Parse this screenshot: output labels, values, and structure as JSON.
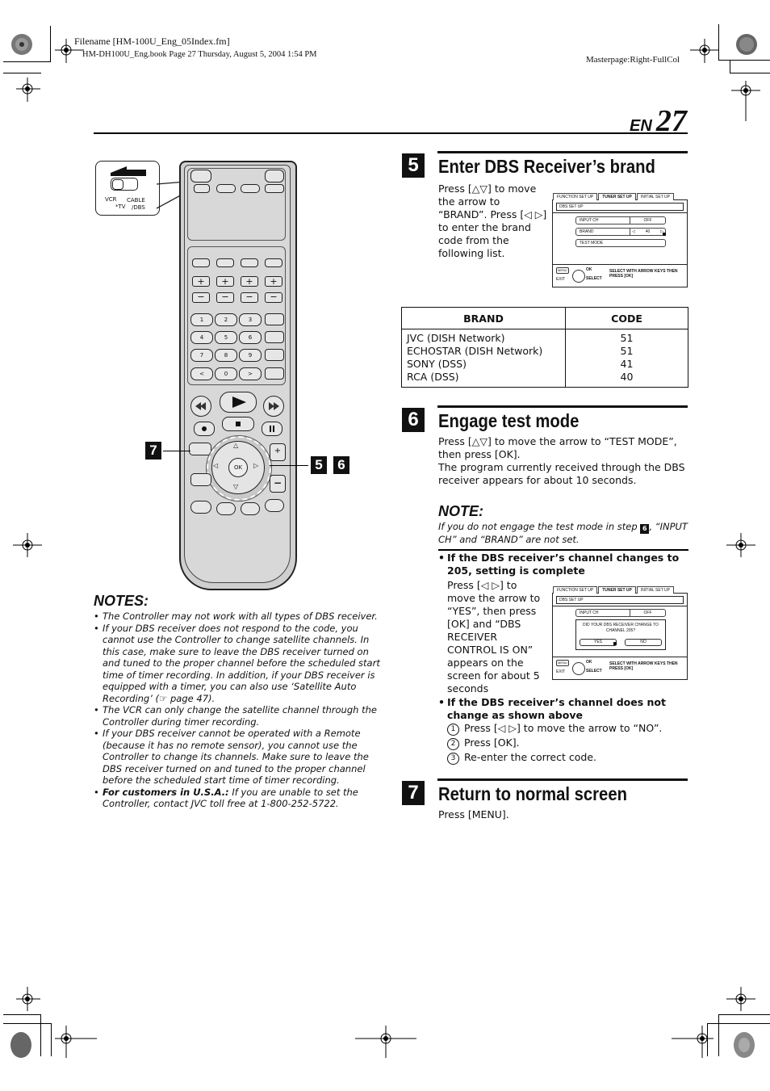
{
  "header": {
    "filename": "Filename [HM-100U_Eng_05Index.fm]",
    "book_info": "HM-DH100U_Eng.book  Page 27  Thursday, August 5, 2004  1:54 PM",
    "masterpage": "Masterpage:Right-FullCol",
    "page_lang": "EN",
    "page_number": "27"
  },
  "remote": {
    "switch_labels": {
      "vcr": "VCR",
      "tv": "*TV",
      "cable": "CABLE",
      "dbs": "/DBS"
    },
    "number_keys": [
      "1",
      "2",
      "3",
      "4",
      "5",
      "6",
      "7",
      "8",
      "9",
      "<",
      "0",
      ">"
    ],
    "ok_label": "OK",
    "callouts": {
      "menu": "7",
      "arrows_a": "5",
      "arrows_b": "6"
    },
    "icons": [
      "play-icon",
      "rewind-icon",
      "fast-forward-icon",
      "record-icon",
      "stop-icon",
      "pause-icon",
      "up-arrow-icon",
      "down-arrow-icon",
      "left-arrow-icon",
      "right-arrow-icon"
    ]
  },
  "notes": {
    "title": "NOTES:",
    "items": [
      {
        "bold": "",
        "text": "The Controller may not work with all types of DBS receiver."
      },
      {
        "bold": "",
        "text": "If your DBS receiver does not respond to the code, you cannot use the Controller to change satellite channels. In this case, make sure to leave the DBS receiver turned on and tuned to the proper channel before the scheduled start time of timer recording. In addition, if your DBS receiver is equipped with a timer, you can also use ‘Satellite Auto Recording’ (☞ page 47)."
      },
      {
        "bold": "",
        "text": "The VCR can only change the satellite channel through the Controller during timer recording."
      },
      {
        "bold": "",
        "text": "If your DBS receiver cannot be operated with a Remote (because it has no remote sensor), you cannot use the Controller to change its channels. Make sure to leave the DBS receiver turned on and tuned to the proper channel before the scheduled start time of timer recording."
      },
      {
        "bold": "For customers in U.S.A.:",
        "text": " If you are unable to set the Controller, contact JVC toll free at 1-800-252-5722."
      }
    ]
  },
  "step5": {
    "number": "5",
    "title": "Enter DBS Receiver’s brand",
    "text": "Press [△▽] to move the arrow to “BRAND”. Press [◁ ▷] to enter the brand code from the following list.",
    "screen": {
      "tabs": [
        "FUNCTION SET UP",
        "TUNER SET UP",
        "INITIAL SET UP"
      ],
      "active_tab": "TUNER SET UP",
      "title": "DBS SET UP",
      "rows": [
        {
          "label": "INPUT CH",
          "value": "OFF"
        },
        {
          "label": "BRAND",
          "value": "40"
        },
        {
          "label": "TEST MODE",
          "value": ""
        }
      ],
      "footer_menu": "MENU",
      "footer_exit": "EXIT",
      "footer_ok": "OK",
      "footer_select": "SELECT",
      "footer_hint": "SELECT WITH ARROW KEYS THEN PRESS [OK]"
    }
  },
  "brand_table": {
    "headers": [
      "BRAND",
      "CODE"
    ],
    "rows": [
      {
        "brand": "JVC (DISH Network)",
        "code": "51"
      },
      {
        "brand": "ECHOSTAR (DISH Network)",
        "code": "51"
      },
      {
        "brand": "SONY (DSS)",
        "code": "41"
      },
      {
        "brand": "RCA (DSS)",
        "code": "40"
      }
    ]
  },
  "step6": {
    "number": "6",
    "title": "Engage test mode",
    "text1": "Press [△▽] to move the arrow to “TEST MODE”, then press [OK].",
    "text2": "The program currently received through the DBS receiver appears for about 10 seconds.",
    "note_title": "NOTE:",
    "note_pre": "If you do not engage the test mode in step ",
    "note_badge": "6",
    "note_post": ", “INPUT CH” and “BRAND” are not set.",
    "case1_title": "If the DBS receiver’s channel changes to 205, setting is complete",
    "case1_text": "Press [◁ ▷] to move the arrow to “YES”, then press [OK] and “DBS RECEIVER CONTROL IS ON” appears on the screen for about 5 seconds",
    "screen2": {
      "tabs": [
        "FUNCTION SET UP",
        "TUNER SET UP",
        "INITIAL SET UP"
      ],
      "title": "DBS SET UP",
      "row_label": "INPUT CH",
      "row_value": "OFF",
      "question": "DID YOUR DBS RECEIVER CHANGE TO CHANNEL 205?",
      "yes": "YES",
      "no": "NO",
      "footer_menu": "MENU",
      "footer_exit": "EXIT",
      "footer_ok": "OK",
      "footer_select": "SELECT",
      "footer_hint": "SELECT WITH ARROW KEYS THEN PRESS [OK]"
    },
    "case2_title": "If the DBS receiver’s channel does not change as shown above",
    "case2_steps": [
      {
        "n": "1",
        "text": "Press [◁ ▷] to move the arrow to “NO”."
      },
      {
        "n": "2",
        "text": "Press [OK]."
      },
      {
        "n": "3",
        "text": "Re-enter the correct code."
      }
    ]
  },
  "step7": {
    "number": "7",
    "title": "Return to normal screen",
    "text": "Press [MENU]."
  }
}
